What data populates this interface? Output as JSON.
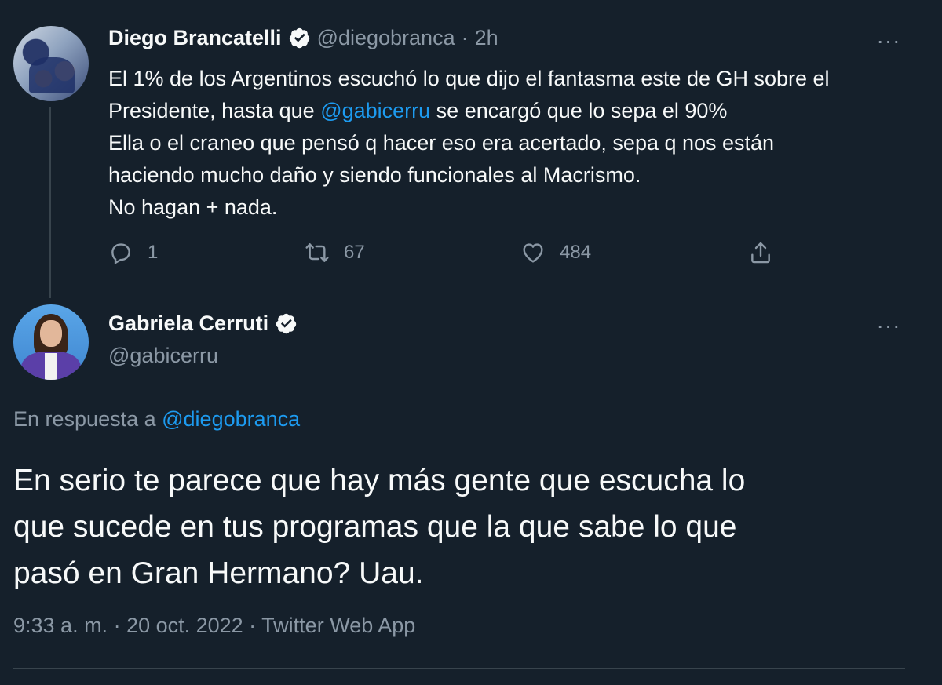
{
  "parent_tweet": {
    "display_name": "Diego Brancatelli",
    "handle": "@diegobranca",
    "separator": "·",
    "time": "2h",
    "more": "···",
    "text": {
      "l1": "El 1% de los Argentinos escuchó lo que dijo el fantasma este de GH sobre el",
      "l2_pre": "Presidente, hasta que ",
      "l2_mention": "@gabicerru",
      "l2_post": " se encargó que lo sepa el 90%",
      "l3": "Ella o el craneo que pensó q hacer eso era acertado, sepa q nos están",
      "l4": "haciendo mucho daño y siendo funcionales al Macrismo.",
      "l5": "No hagan + nada."
    },
    "actions": {
      "replies": "1",
      "retweets": "67",
      "likes": "484"
    }
  },
  "main_tweet": {
    "display_name": "Gabriela Cerruti",
    "handle": "@gabicerru",
    "more": "···",
    "reply_prefix": "En respuesta a ",
    "reply_mention": "@diegobranca",
    "text": {
      "l1": "En serio te parece que hay más gente que escucha lo",
      "l2": "que sucede en tus programas que la que sabe lo que",
      "l3": "pasó en Gran Hermano? Uau."
    },
    "meta": "9:33 a. m. · 20 oct. 2022 · Twitter Web App"
  },
  "colors": {
    "background": "#15202b",
    "text": "#f7f9f9",
    "secondary": "#8b98a5",
    "link": "#1d9bf0",
    "border": "#38444d"
  }
}
